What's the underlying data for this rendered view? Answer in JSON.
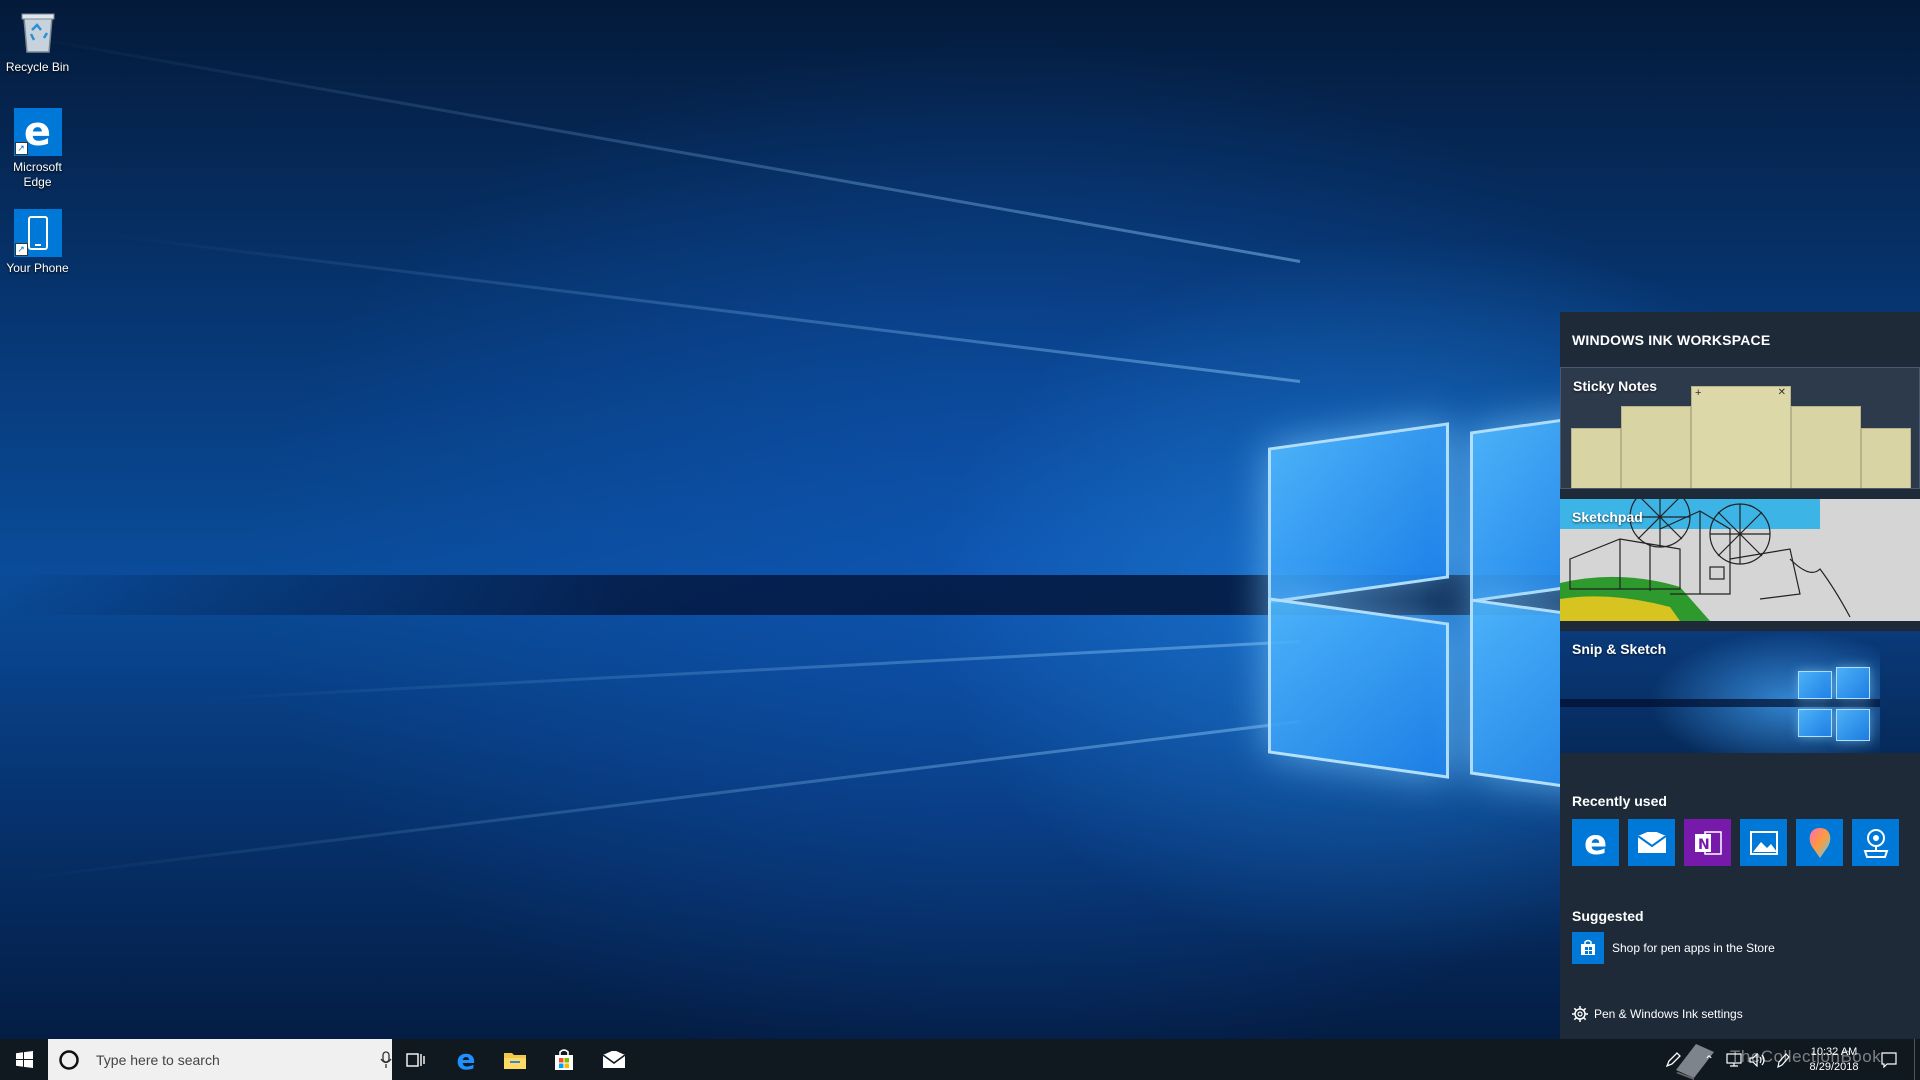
{
  "desktop": {
    "icons": [
      {
        "label": "Recycle Bin",
        "icon": "recycle-bin-icon"
      },
      {
        "label": "Microsoft Edge",
        "icon": "edge-icon"
      },
      {
        "label": "Your Phone",
        "icon": "phone-icon"
      }
    ]
  },
  "ink_workspace": {
    "title": "WINDOWS INK WORKSPACE",
    "tiles": [
      {
        "label": "Sticky Notes"
      },
      {
        "label": "Sketchpad"
      },
      {
        "label": "Snip & Sketch"
      }
    ],
    "recently_used_title": "Recently used",
    "recently_used": [
      {
        "icon": "edge-icon",
        "color": "#0078d7"
      },
      {
        "icon": "mail-icon",
        "color": "#0078d7"
      },
      {
        "icon": "onenote-icon",
        "color": "#7719aa"
      },
      {
        "icon": "photos-icon",
        "color": "#0078d7"
      },
      {
        "icon": "paint3d-icon",
        "color": "#0078d7"
      },
      {
        "icon": "maps-icon",
        "color": "#0078d7"
      }
    ],
    "suggested_title": "Suggested",
    "suggested_item": "Shop for pen apps in the Store",
    "settings_label": "Pen & Windows Ink settings"
  },
  "taskbar": {
    "search_placeholder": "Type here to search",
    "pinned": [
      "task-view-icon",
      "edge-icon",
      "file-explorer-icon",
      "store-icon",
      "mail-icon"
    ],
    "clock_time": "10:32 AM",
    "clock_date": "8/29/2018",
    "watermark": "TheCollectionBook"
  },
  "colors": {
    "accent": "#0078d7",
    "panel_bg": "#1e2a38",
    "taskbar_bg": "#101820",
    "onenote": "#7719aa"
  }
}
